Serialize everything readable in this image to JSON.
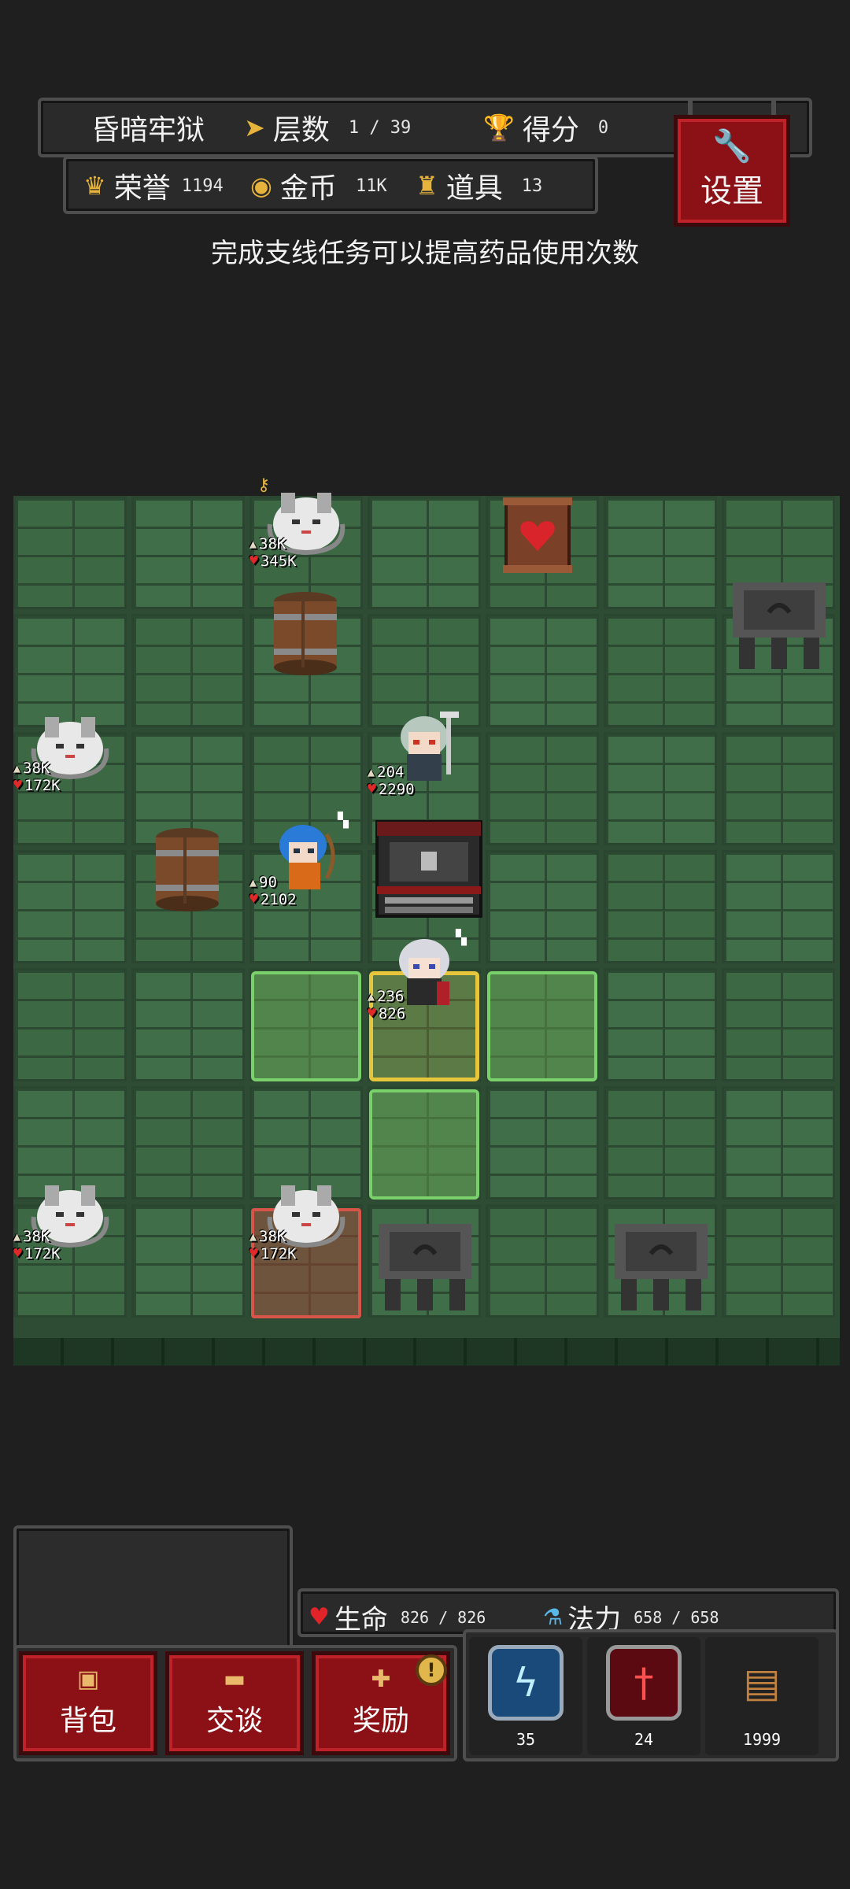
{
  "header": {
    "dungeon_name": "昏暗牢狱",
    "floor_label": "层数",
    "floor_value": "1 / 39",
    "score_label": "得分",
    "score_value": "0",
    "honor_label": "荣誉",
    "honor_value": "1194",
    "gold_label": "金币",
    "gold_value": "11K",
    "items_label": "道具",
    "items_value": "13",
    "settings_label": "设置"
  },
  "hint": "完成支线任务可以提高药品使用次数",
  "units": {
    "enemy1": {
      "atk": "38K",
      "hp": "345K"
    },
    "enemy2": {
      "atk": "38K",
      "hp": "172K"
    },
    "enemy3": {
      "atk": "38K",
      "hp": "172K"
    },
    "enemy4": {
      "atk": "38K",
      "hp": "172K"
    },
    "ally_knight": {
      "atk": "204",
      "hp": "2290"
    },
    "ally_archer": {
      "atk": "90",
      "hp": "2102"
    },
    "hero": {
      "atk": "236",
      "hp": "826"
    }
  },
  "resources": {
    "life_label": "生命",
    "life_value": "826 / 826",
    "mana_label": "法力",
    "mana_value": "658 / 658"
  },
  "actions": {
    "bag": "背包",
    "talk": "交谈",
    "reward": "奖励",
    "alert": "!"
  },
  "skills": {
    "lightning_count": "35",
    "sword_count": "24",
    "chest_count": "1999"
  },
  "colors": {
    "button_red": "#8b1117",
    "floor_green": "#3c6844",
    "move_highlight": "#7ad06a",
    "selected_highlight": "#e8c63c",
    "enemy_highlight": "#d65548"
  }
}
